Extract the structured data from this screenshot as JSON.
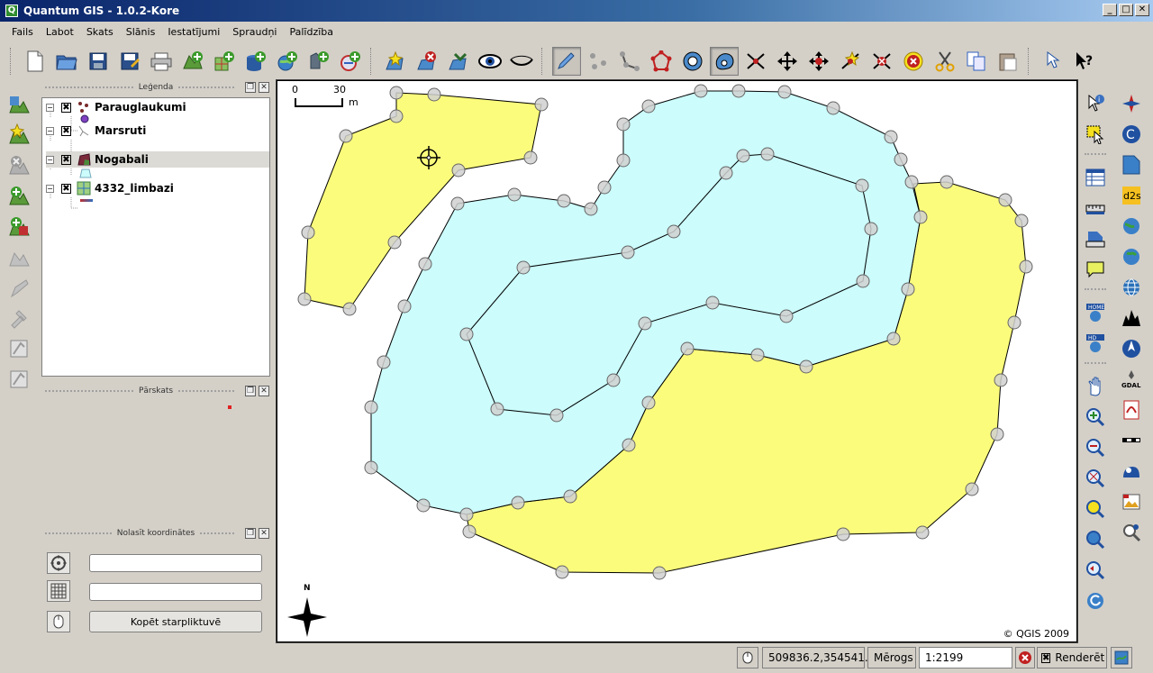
{
  "window": {
    "title": "Quantum GIS - 1.0.2-Kore",
    "app_icon": "Q",
    "minimize": "_",
    "maximize": "□",
    "close": "✕"
  },
  "menu": [
    "Fails",
    "Labot",
    "Skats",
    "Slānis",
    "Iestatījumi",
    "Spraudņi",
    "Palīdzība"
  ],
  "toolbar": {
    "icons": [
      "new-project-icon",
      "open-project-icon",
      "save-project-icon",
      "save-as-icon",
      "print-icon",
      "add-vector-icon",
      "add-raster-icon",
      "add-postgis-icon",
      "add-wms-icon",
      "add-spatialite-icon",
      "add-wfs-icon",
      "new-vector-icon",
      "remove-layer-icon",
      "add-all-icon",
      "show-all-icon",
      "hide-all-icon",
      "toggle-edit-icon",
      "capture-point-icon",
      "capture-line-icon",
      "capture-polygon-icon",
      "add-ring-icon",
      "add-island-icon",
      "move-feature-icon",
      "split-features-icon",
      "move-vertex-icon",
      "add-vertex-icon",
      "delete-vertex-icon",
      "delete-selected-icon",
      "cut-icon",
      "copy-icon",
      "paste-icon",
      "what-is-this-icon",
      "help-icon"
    ]
  },
  "legend": {
    "title": "Leģenda",
    "float": "❐",
    "close": "✕",
    "layers": [
      {
        "name": "Parauglaukumi",
        "expander": "−",
        "checked": "✖"
      },
      {
        "name": "Marsruti",
        "expander": "−",
        "checked": "✖"
      },
      {
        "name": "Nogabali",
        "expander": "−",
        "checked": "✖"
      },
      {
        "name": "4332_limbazi",
        "expander": "−",
        "checked": "✖"
      }
    ]
  },
  "overview": {
    "title": "Pārskats",
    "float": "❐",
    "close": "✕"
  },
  "coords_panel": {
    "title": "Nolasīt koordinātes",
    "float": "❐",
    "close": "✕",
    "copy_button": "Kopēt starpliktuvē",
    "field1_value": "",
    "field2_value": ""
  },
  "map": {
    "scale_left": "0",
    "scale_right": "30",
    "scale_unit": "m",
    "north": "N",
    "copyright": "© QGIS 2009",
    "colors": {
      "yellow_fill": "#fcfc7c",
      "blue_fill": "#ccfcfc",
      "vertex_fill": "#d0d0d0"
    }
  },
  "statusbar": {
    "coordinates": "509836.2,354541.8",
    "scale_label": "Mērogs",
    "scale_value": "1:2199",
    "render_label": "Renderēt",
    "render_checked": "✖"
  }
}
